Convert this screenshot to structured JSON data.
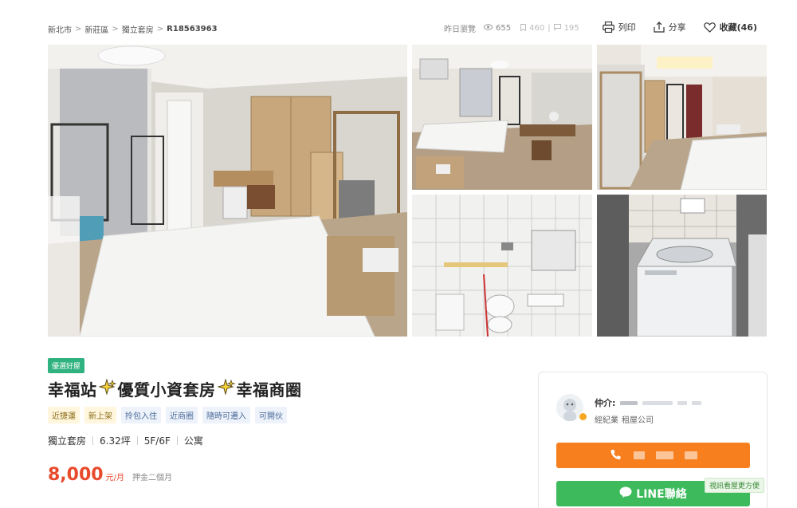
{
  "breadcrumb": {
    "items": [
      "新北市",
      "新莊區",
      "獨立套房"
    ],
    "listing_id": "R18563963",
    "separator": ">"
  },
  "stats": {
    "yesterday_label": "昨日瀏覽",
    "views": "655",
    "saves": "460",
    "comments": "195"
  },
  "actions": {
    "print": "列印",
    "share": "分享",
    "favorite": "收藏(46)"
  },
  "listing": {
    "badge": "優選好屋",
    "title_part1": "幸福站",
    "title_part2": "優質小資套房",
    "title_part3": "幸福商圈",
    "tags": [
      {
        "label": "近捷運",
        "style": "yellow"
      },
      {
        "label": "新上架",
        "style": "yellow"
      },
      {
        "label": "拎包入住",
        "style": "blue"
      },
      {
        "label": "近商圈",
        "style": "blue"
      },
      {
        "label": "隨時可遷入",
        "style": "blue"
      },
      {
        "label": "可開伙",
        "style": "blue"
      }
    ],
    "specs": [
      "獨立套房",
      "6.32坪",
      "5F/6F",
      "公寓"
    ],
    "price": "8,000",
    "price_unit": "元/月",
    "deposit": "押金二個月"
  },
  "agent": {
    "label": "仲介:",
    "role_type": "經紀業",
    "company": "租屋公司",
    "call_icon": "phone-icon",
    "line_label": "LINE聯絡",
    "video_tip": "視訊看屋更方便"
  },
  "colors": {
    "price": "#e84a2b",
    "call_button": "#f77f1e",
    "line_button": "#3dbb5c",
    "good_badge": "#2fb27f"
  }
}
